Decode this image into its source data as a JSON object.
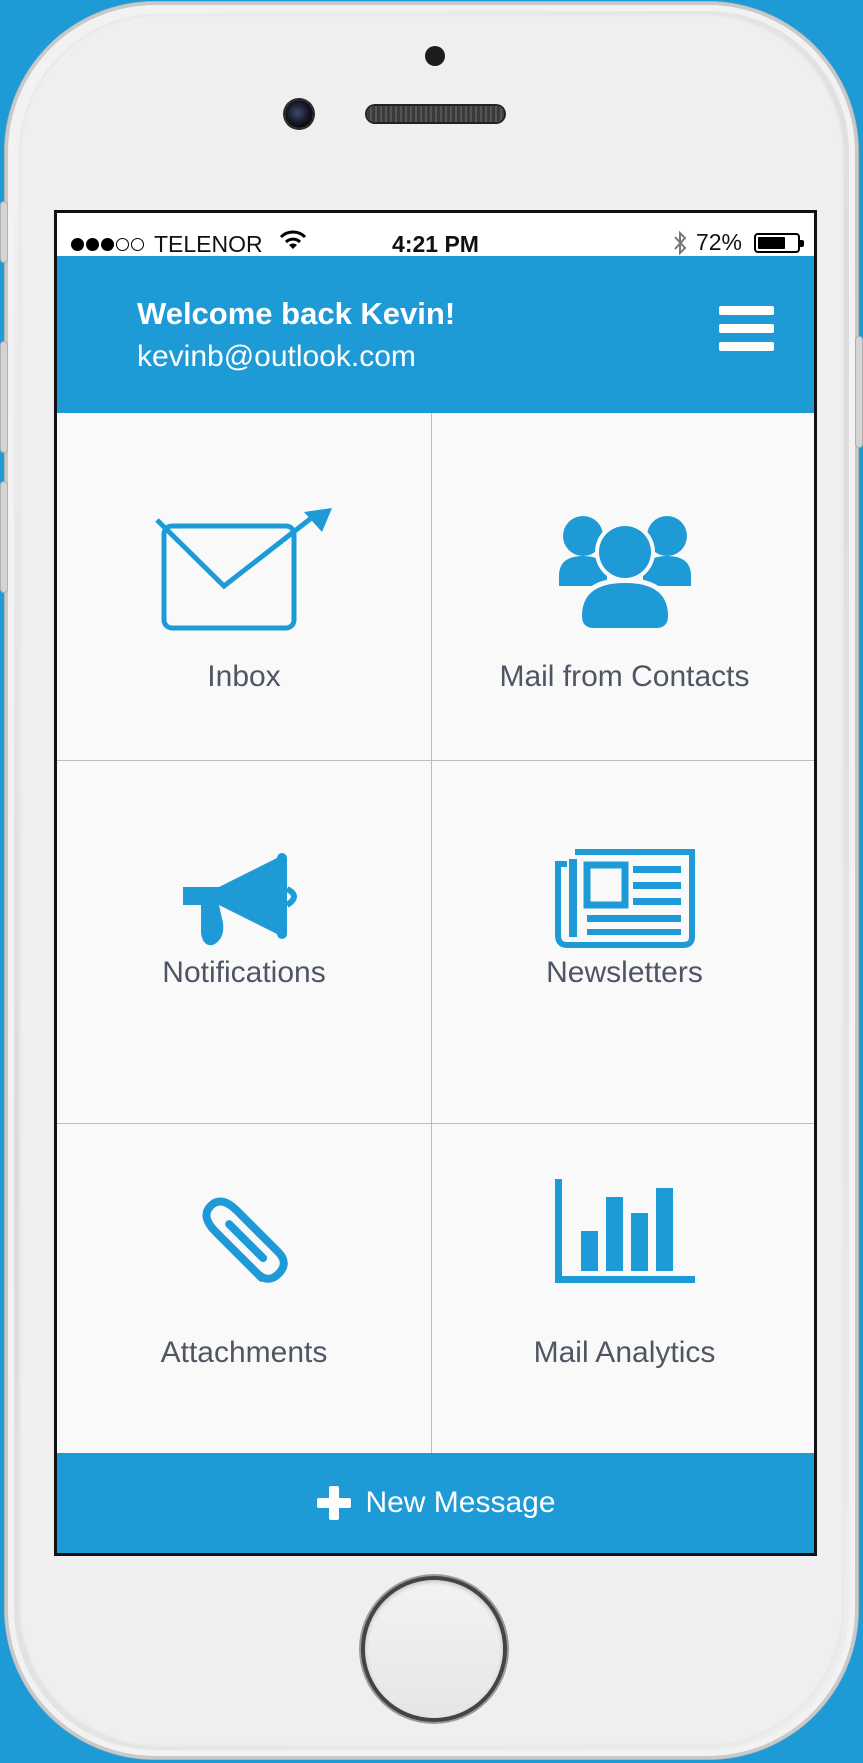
{
  "colors": {
    "accent": "#1e9bd7",
    "background": "#1e9bd7",
    "tile_text": "#4f5565",
    "divider": "#bcbcbc"
  },
  "status_bar": {
    "carrier": "TELENOR",
    "signal_bars_filled": 3,
    "signal_bars_total": 5,
    "time": "4:21 PM",
    "battery": "72%",
    "battery_level": 0.72
  },
  "header": {
    "title": "Welcome back Kevin!",
    "email": "kevinb@outlook.com",
    "menu_icon": "hamburger-menu-icon"
  },
  "tiles": [
    {
      "label": "Inbox",
      "icon": "envelope-send-icon"
    },
    {
      "label": "Mail from Contacts",
      "icon": "people-group-icon"
    },
    {
      "label": "Notifications",
      "icon": "megaphone-icon"
    },
    {
      "label": "Newsletters",
      "icon": "newspaper-icon"
    },
    {
      "label": "Attachments",
      "icon": "paperclip-icon"
    },
    {
      "label": "Mail Analytics",
      "icon": "bar-chart-icon"
    }
  ],
  "footer": {
    "new_message_label": "New Message",
    "icon": "plus-icon"
  }
}
